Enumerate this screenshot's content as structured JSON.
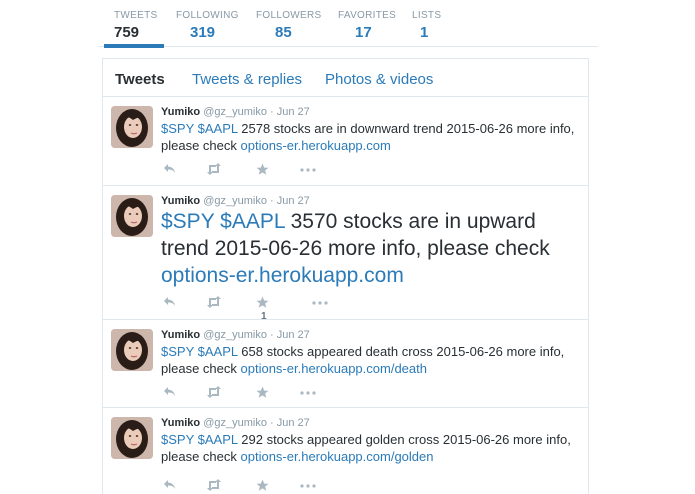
{
  "stats": [
    {
      "label": "TWEETS",
      "value": "759"
    },
    {
      "label": "FOLLOWING",
      "value": "319"
    },
    {
      "label": "FOLLOWERS",
      "value": "85"
    },
    {
      "label": "FAVORITES",
      "value": "17"
    },
    {
      "label": "LISTS",
      "value": "1"
    }
  ],
  "tabs": [
    {
      "label": "Tweets"
    },
    {
      "label": "Tweets & replies"
    },
    {
      "label": "Photos & videos"
    }
  ],
  "tweets": [
    {
      "name": "Yumiko",
      "handle": "@gz_yumiko",
      "sep": "·",
      "time": "Jun 27",
      "cash1": "$SPY",
      "cash2": "$AAPL",
      "body": "2578 stocks are in downward trend 2015-06-26 more info, please check",
      "link": "options-er.herokuapp.com",
      "fav_count": ""
    },
    {
      "name": "Yumiko",
      "handle": "@gz_yumiko",
      "sep": "·",
      "time": "Jun 27",
      "cash1": "$SPY",
      "cash2": "$AAPL",
      "body": "3570 stocks are in upward trend 2015-06-26 more info, please check",
      "link": "options-er.herokuapp.com",
      "fav_count": "1"
    },
    {
      "name": "Yumiko",
      "handle": "@gz_yumiko",
      "sep": "·",
      "time": "Jun 27",
      "cash1": "$SPY",
      "cash2": "$AAPL",
      "body": "658 stocks appeared death cross 2015-06-26 more info, please check",
      "link": "options-er.herokuapp.com/death",
      "fav_count": ""
    },
    {
      "name": "Yumiko",
      "handle": "@gz_yumiko",
      "sep": "·",
      "time": "Jun 27",
      "cash1": "$SPY",
      "cash2": "$AAPL",
      "body": "292 stocks appeared golden cross 2015-06-26 more info, please check",
      "link": "options-er.herokuapp.com/golden",
      "fav_count": ""
    }
  ],
  "colors": {
    "accent": "#2b7bb9",
    "muted": "#8899a6",
    "border": "#e1e8ed",
    "text": "#292f33"
  }
}
